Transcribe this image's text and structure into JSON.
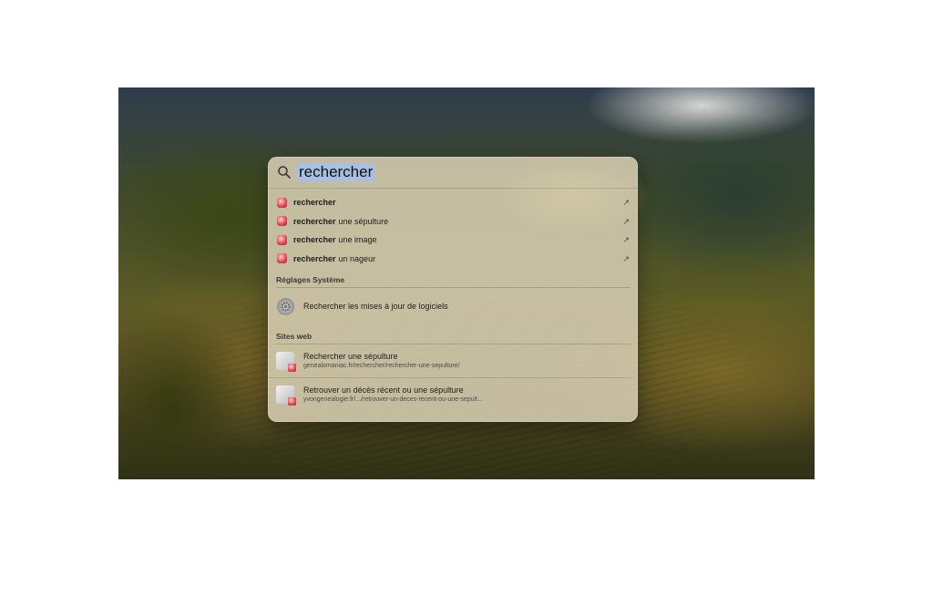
{
  "search": {
    "query": "rechercher"
  },
  "suggestions": [
    {
      "bold": "rechercher",
      "rest": "",
      "arrow": "↗"
    },
    {
      "bold": "rechercher",
      "rest": "une sépulture",
      "arrow": "↗"
    },
    {
      "bold": "rechercher",
      "rest": "une image",
      "arrow": "↗"
    },
    {
      "bold": "rechercher",
      "rest": "un nageur",
      "arrow": "↗"
    }
  ],
  "sections": {
    "system": {
      "title": "Réglages Système",
      "items": [
        {
          "label": "Rechercher les mises à jour de logiciels",
          "icon": "gear-icon"
        }
      ]
    },
    "web": {
      "title": "Sites web",
      "items": [
        {
          "title": "Rechercher une sépulture",
          "url": "genealomaniac.fr/rechercher/rechercher-une-sepulture/"
        },
        {
          "title": "Retrouver un décès récent ou une sépulture",
          "url": "yvongenealogie.fr/.../retrouver-un-deces-recent-ou-une-sepult..."
        }
      ]
    }
  },
  "colors": {
    "selection": "#a7bfe0",
    "panel": "#d6cdb2"
  }
}
